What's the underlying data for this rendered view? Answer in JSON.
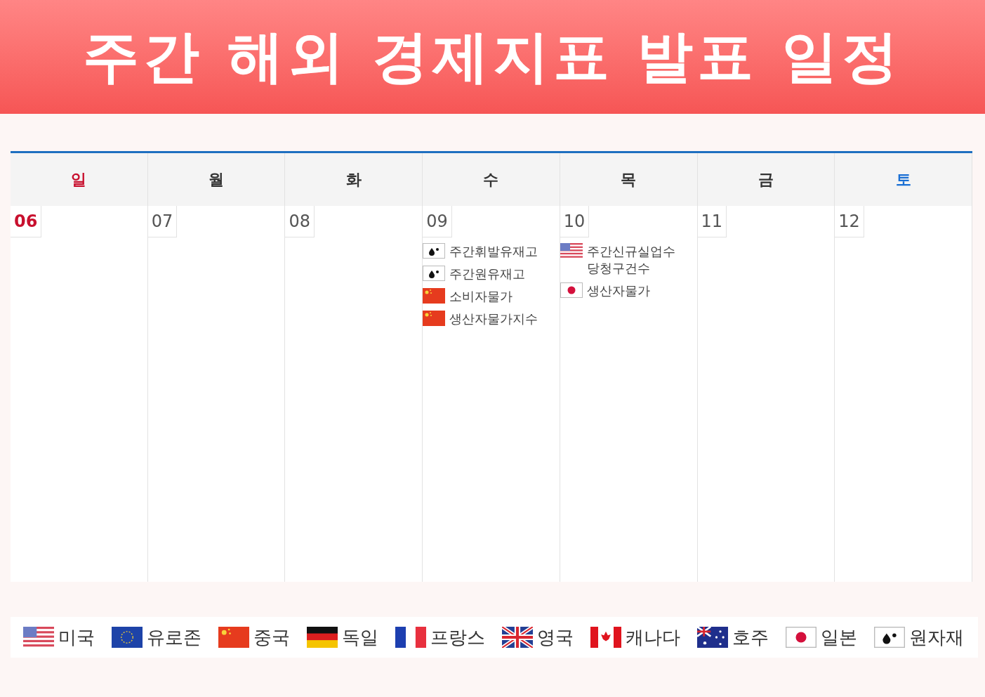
{
  "title": "주간 해외 경제지표 발표 일정",
  "weekdays": [
    {
      "label": "일",
      "kind": "sunday"
    },
    {
      "label": "월",
      "kind": "weekday"
    },
    {
      "label": "화",
      "kind": "weekday"
    },
    {
      "label": "수",
      "kind": "weekday"
    },
    {
      "label": "목",
      "kind": "weekday"
    },
    {
      "label": "금",
      "kind": "weekday"
    },
    {
      "label": "토",
      "kind": "saturday"
    }
  ],
  "days": [
    {
      "date": "06",
      "kind": "sunday"
    },
    {
      "date": "07",
      "kind": "weekday"
    },
    {
      "date": "08",
      "kind": "weekday"
    },
    {
      "date": "09",
      "kind": "weekday",
      "events": [
        {
          "kind": "commodity",
          "label": "주간휘발유재고"
        },
        {
          "kind": "commodity",
          "label": "주간원유재고"
        },
        {
          "kind": "cn",
          "label": "소비자물가"
        },
        {
          "kind": "cn",
          "label": "생산자물가지수"
        }
      ]
    },
    {
      "date": "10",
      "kind": "weekday",
      "events": [
        {
          "kind": "us",
          "label": "주간신규실업수당청구건수"
        },
        {
          "kind": "jp",
          "label": "생산자물가"
        }
      ]
    },
    {
      "date": "11",
      "kind": "weekday"
    },
    {
      "date": "12",
      "kind": "saturday"
    }
  ],
  "legend": [
    {
      "kind": "us",
      "label": "미국"
    },
    {
      "kind": "eu",
      "label": "유로존"
    },
    {
      "kind": "cn",
      "label": "중국"
    },
    {
      "kind": "de",
      "label": "독일"
    },
    {
      "kind": "fr",
      "label": "프랑스"
    },
    {
      "kind": "gb",
      "label": "영국"
    },
    {
      "kind": "ca",
      "label": "캐나다"
    },
    {
      "kind": "au",
      "label": "호주"
    },
    {
      "kind": "jp",
      "label": "일본"
    },
    {
      "kind": "commodity",
      "label": "원자재"
    }
  ]
}
